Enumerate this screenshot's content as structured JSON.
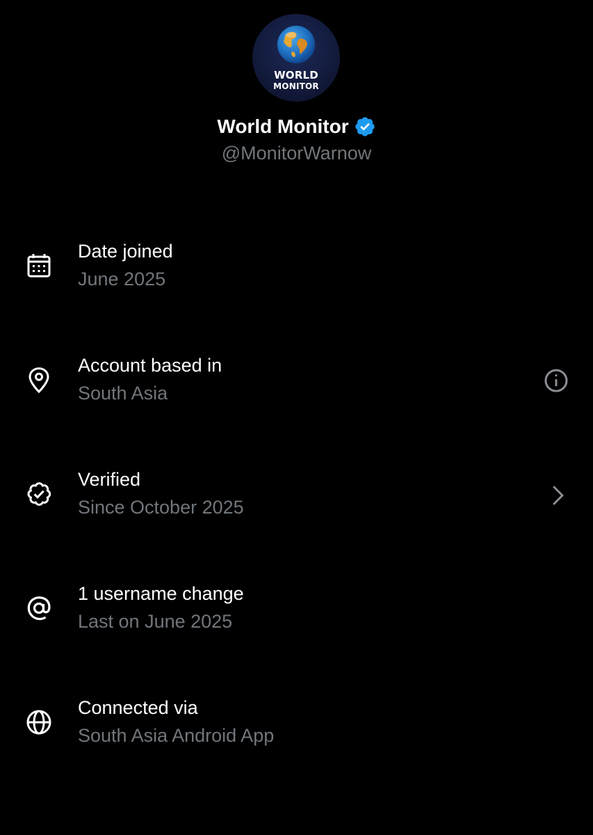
{
  "profile": {
    "avatar_lines": [
      "WORLD",
      "MONITOR"
    ],
    "display_name": "World Monitor",
    "handle": "@MonitorWarnow",
    "verified_badge_icon": "verified-badge-icon",
    "verified_color": "#1d9bf0"
  },
  "rows": [
    {
      "icon": "calendar-icon",
      "title": "Date joined",
      "subtitle": "June 2025",
      "action": null
    },
    {
      "icon": "location-pin-icon",
      "title": "Account based in",
      "subtitle": "South Asia",
      "action": "info-icon"
    },
    {
      "icon": "verified-outline-icon",
      "title": "Verified",
      "subtitle": "Since October 2025",
      "action": "chevron-right-icon"
    },
    {
      "icon": "at-sign-icon",
      "title": "1 username change",
      "subtitle": "Last on June 2025",
      "action": null
    },
    {
      "icon": "globe-icon",
      "title": "Connected via",
      "subtitle": "South Asia Android App",
      "action": null
    }
  ],
  "colors": {
    "background": "#000000",
    "primary_text": "#ffffff",
    "secondary_text": "#71767b",
    "icon_color": "#ffffff",
    "action_icon_color": "#8b8f94"
  }
}
